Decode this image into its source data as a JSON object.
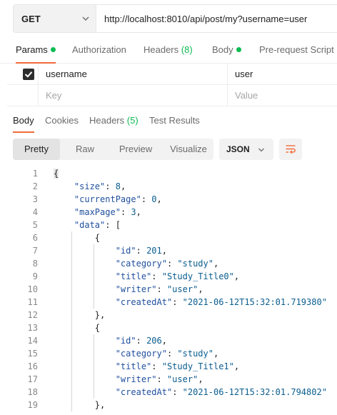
{
  "request": {
    "method": "GET",
    "url": "http://localhost:8010/api/post/my?username=user"
  },
  "request_tabs": {
    "params": "Params",
    "authorization": "Authorization",
    "headers": "Headers",
    "headers_count": "(8)",
    "body": "Body",
    "pre_request": "Pre-request Script"
  },
  "params": {
    "rows": [
      {
        "key": "username",
        "value": "user",
        "checked": true
      }
    ],
    "key_placeholder": "Key",
    "value_placeholder": "Value"
  },
  "response_tabs": {
    "body": "Body",
    "cookies": "Cookies",
    "headers": "Headers",
    "headers_count": "(5)",
    "test_results": "Test Results"
  },
  "view_modes": {
    "pretty": "Pretty",
    "raw": "Raw",
    "preview": "Preview",
    "visualize": "Visualize"
  },
  "format": "JSON",
  "colors": {
    "accent": "#f26b3a",
    "success": "#0cbb52",
    "json_key": "#1f4f9e",
    "json_value": "#0a5d8f"
  },
  "code": {
    "line_numbers": [
      "1",
      "2",
      "3",
      "4",
      "5",
      "6",
      "7",
      "8",
      "9",
      "10",
      "11",
      "12",
      "13",
      "14",
      "15",
      "16",
      "17",
      "18",
      "19"
    ],
    "lines": [
      "{",
      "    \"size\": 8,",
      "    \"currentPage\": 0,",
      "    \"maxPage\": 3,",
      "    \"data\": [",
      "        {",
      "            \"id\": 201,",
      "            \"category\": \"study\",",
      "            \"title\": \"Study_Title0\",",
      "            \"writer\": \"user\",",
      "            \"createdAt\": \"2021-06-12T15:32:01.719380\"",
      "        },",
      "        {",
      "            \"id\": 206,",
      "            \"category\": \"study\",",
      "            \"title\": \"Study_Title1\",",
      "            \"writer\": \"user\",",
      "            \"createdAt\": \"2021-06-12T15:32:01.794802\"",
      "        },"
    ]
  }
}
